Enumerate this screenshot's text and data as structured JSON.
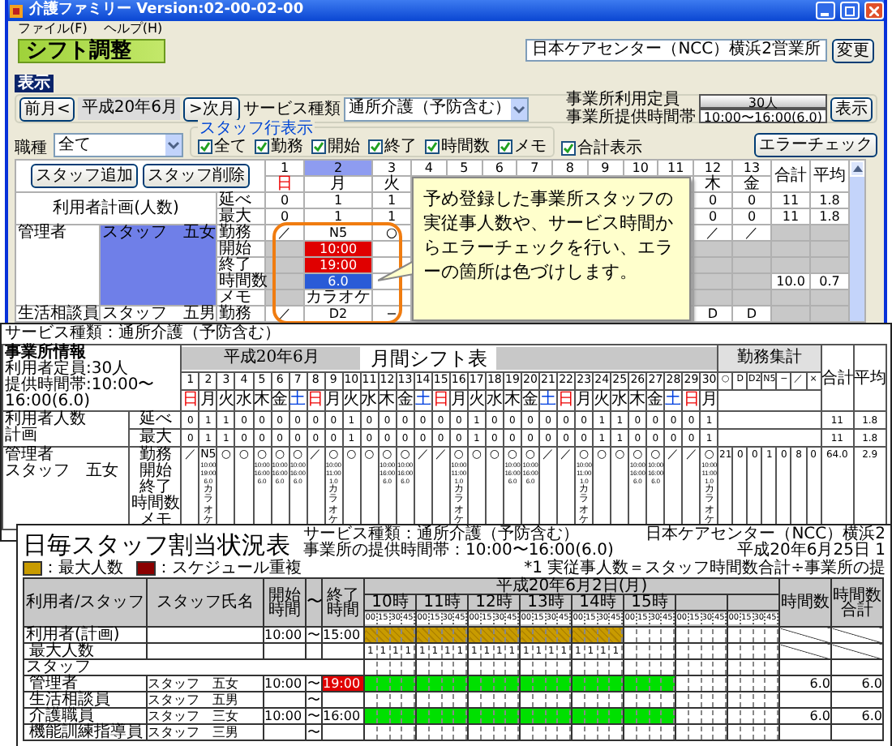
{
  "app_window": {
    "title": "介護ファミリー Version:02-00-02-00",
    "menu": [
      "ファイル(F)",
      "ヘルプ(H)"
    ],
    "heading": "シフト調整",
    "office": "日本ケアセンター（NCC）横浜2営業所",
    "change_button": "変更",
    "section_label": "表示",
    "prev_button": "前月<",
    "month": "平成20年6月",
    "next_button": ">次月",
    "service_label": "サービス種類",
    "service_value": "通所介護（予防含む）",
    "capacity_label": "事業所利用定員",
    "capacity_value": "30人",
    "hours_label": "事業所提供時間帯",
    "hours_value": "10:00〜16:00(6.0)",
    "show_button": "表示",
    "job_label": "職種",
    "job_value": "全て",
    "staff_rows_legend": "スタッフ行表示",
    "row_options": [
      {
        "label": "全て",
        "checked": true
      },
      {
        "label": "勤務",
        "checked": true
      },
      {
        "label": "開始",
        "checked": true
      },
      {
        "label": "終了",
        "checked": true
      },
      {
        "label": "時間数",
        "checked": true
      },
      {
        "label": "メモ",
        "checked": true
      }
    ],
    "total_option": {
      "label": "合計表示",
      "checked": true
    },
    "error_check_button": "エラーチェック",
    "add_staff_button": "スタッフ追加",
    "delete_staff_button": "スタッフ削除",
    "days": [
      {
        "num": "1",
        "dow": "日",
        "kind": "sunday",
        "selected": false
      },
      {
        "num": "2",
        "dow": "月",
        "kind": "weekday",
        "selected": true
      },
      {
        "num": "3",
        "dow": "火",
        "kind": "weekday",
        "selected": false
      },
      {
        "num": "4",
        "selected": false
      },
      {
        "num": "5",
        "selected": false
      },
      {
        "num": "6",
        "selected": false
      },
      {
        "num": "7",
        "selected": false
      },
      {
        "num": "8",
        "selected": false
      },
      {
        "num": "9",
        "selected": false
      },
      {
        "num": "10",
        "selected": false
      },
      {
        "num": "11",
        "selected": false
      },
      {
        "num": "12",
        "dow": "木",
        "kind": "weekday",
        "selected": false
      },
      {
        "num": "13",
        "dow": "金",
        "kind": "weekday",
        "selected": false
      }
    ],
    "total_header": "合計",
    "average_header": "平均",
    "plan_label": "利用者計画(人数)",
    "plan_rows": [
      {
        "label": "延べ",
        "total": "11",
        "average": "1.8",
        "cells": [
          "0",
          "1",
          "1"
        ],
        "end_cells": [
          "0",
          "0"
        ]
      },
      {
        "label": "最大",
        "total": "11",
        "average": "1.8",
        "cells": [
          "0",
          "1",
          "1"
        ],
        "end_cells": [
          "0",
          "0"
        ]
      }
    ],
    "staff": [
      {
        "role": "管理者",
        "name": "スタッフ　五女",
        "selected": true,
        "rows": [
          {
            "label": "勤務",
            "cells": [
              {
                "kind": "plain",
                "text": "／"
              },
              {
                "kind": "plain",
                "text": "N5"
              },
              {
                "kind": "plain",
                "text": "○"
              }
            ],
            "end_cells": [
              {
                "kind": "plain",
                "text": "／"
              },
              {
                "kind": "plain",
                "text": "／"
              }
            ]
          },
          {
            "label": "開始",
            "cells": [
              {
                "kind": "gray"
              },
              {
                "kind": "error",
                "text": "10:00"
              },
              {
                "kind": "plain"
              }
            ],
            "end_cells": [
              {
                "kind": "gray"
              },
              {
                "kind": "gray"
              }
            ]
          },
          {
            "label": "終了",
            "cells": [
              {
                "kind": "gray"
              },
              {
                "kind": "error",
                "text": "19:00"
              },
              {
                "kind": "plain"
              }
            ],
            "end_cells": [
              {
                "kind": "gray"
              },
              {
                "kind": "gray"
              }
            ]
          },
          {
            "label": "時間数",
            "total": "10.0",
            "average": "0.7",
            "cells": [
              {
                "kind": "gray"
              },
              {
                "kind": "active",
                "text": "6.0"
              },
              {
                "kind": "plain"
              }
            ],
            "end_cells": [
              {
                "kind": "gray"
              },
              {
                "kind": "gray"
              }
            ]
          },
          {
            "label": "メモ",
            "cells": [
              {
                "kind": "gray"
              },
              {
                "kind": "plain",
                "text": "カラオケ"
              },
              {
                "kind": "plain"
              }
            ],
            "end_cells": [
              {
                "kind": "gray"
              },
              {
                "kind": "gray"
              }
            ]
          }
        ]
      },
      {
        "role": "生活相談員",
        "name": "スタッフ　五男",
        "selected": false,
        "rows": [
          {
            "label": "勤務",
            "cells": [
              {
                "kind": "plain",
                "text": "／"
              },
              {
                "kind": "plain",
                "text": "D2"
              },
              {
                "kind": "plain",
                "text": "−"
              }
            ],
            "end_cells": [
              {
                "kind": "plain",
                "text": "D"
              },
              {
                "kind": "plain",
                "text": "D"
              }
            ]
          }
        ]
      }
    ],
    "callout": "予め登録した事業所スタッフの実従事人数や、サービス時間からエラーチェックを行い、エラーの箇所は色づけします。"
  },
  "monthly_sheet": {
    "service": "サービス種類：通所介護（予防含む）",
    "info_labels": [
      "事業所情報",
      "利用者定員:30人",
      "提供時間帯:10:00〜16:00(6.0)"
    ],
    "month": "平成20年6月",
    "title": "月間シフト表",
    "summary_header": "勤務集計",
    "summary_symbols": [
      "○",
      "D",
      "D2",
      "N5",
      "−",
      "／",
      "×"
    ],
    "total_header": "合計",
    "average_header": "平均",
    "days": [
      {
        "num": "1",
        "dow": "日",
        "kind": "sunday"
      },
      {
        "num": "2",
        "dow": "月",
        "kind": "weekday"
      },
      {
        "num": "3",
        "dow": "火",
        "kind": "weekday"
      },
      {
        "num": "4",
        "dow": "水",
        "kind": "weekday"
      },
      {
        "num": "5",
        "dow": "木",
        "kind": "weekday"
      },
      {
        "num": "6",
        "dow": "金",
        "kind": "weekday"
      },
      {
        "num": "7",
        "dow": "土",
        "kind": "saturday"
      },
      {
        "num": "8",
        "dow": "日",
        "kind": "sunday"
      },
      {
        "num": "9",
        "dow": "月",
        "kind": "weekday"
      },
      {
        "num": "10",
        "dow": "火",
        "kind": "weekday"
      },
      {
        "num": "11",
        "dow": "水",
        "kind": "weekday"
      },
      {
        "num": "12",
        "dow": "木",
        "kind": "weekday"
      },
      {
        "num": "13",
        "dow": "金",
        "kind": "weekday"
      },
      {
        "num": "14",
        "dow": "土",
        "kind": "saturday"
      },
      {
        "num": "15",
        "dow": "日",
        "kind": "sunday"
      },
      {
        "num": "16",
        "dow": "月",
        "kind": "weekday"
      },
      {
        "num": "17",
        "dow": "火",
        "kind": "weekday"
      },
      {
        "num": "18",
        "dow": "水",
        "kind": "weekday"
      },
      {
        "num": "19",
        "dow": "木",
        "kind": "weekday"
      },
      {
        "num": "20",
        "dow": "金",
        "kind": "weekday"
      },
      {
        "num": "21",
        "dow": "土",
        "kind": "saturday"
      },
      {
        "num": "22",
        "dow": "日",
        "kind": "sunday"
      },
      {
        "num": "23",
        "dow": "月",
        "kind": "weekday"
      },
      {
        "num": "24",
        "dow": "火",
        "kind": "weekday"
      },
      {
        "num": "25",
        "dow": "水",
        "kind": "weekday"
      },
      {
        "num": "26",
        "dow": "木",
        "kind": "weekday"
      },
      {
        "num": "27",
        "dow": "金",
        "kind": "weekday"
      },
      {
        "num": "28",
        "dow": "土",
        "kind": "saturday"
      },
      {
        "num": "29",
        "dow": "日",
        "kind": "sunday"
      },
      {
        "num": "30",
        "dow": "月",
        "kind": "weekday"
      }
    ],
    "plan_labels": [
      "利用者人数",
      "計画"
    ],
    "plan_rows": [
      {
        "label": "延べ",
        "total": "11",
        "average": "1.8",
        "values": [
          "0",
          "1",
          "1",
          "0",
          "0",
          "0",
          "0",
          "0",
          "0",
          "1",
          "0",
          "0",
          "0",
          "0",
          "0",
          "0",
          "1",
          "0",
          "0",
          "0",
          "0",
          "0",
          "0",
          "1",
          "1",
          "0",
          "0",
          "0",
          "0",
          "1"
        ]
      },
      {
        "label": "最大",
        "total": "11",
        "average": "1.8",
        "values": [
          "0",
          "1",
          "1",
          "0",
          "0",
          "0",
          "0",
          "0",
          "0",
          "1",
          "0",
          "0",
          "0",
          "0",
          "0",
          "0",
          "1",
          "0",
          "0",
          "0",
          "0",
          "0",
          "0",
          "1",
          "1",
          "0",
          "0",
          "0",
          "0",
          "1"
        ]
      }
    ],
    "staff": [
      {
        "role": "管理者",
        "name": "スタッフ　五女",
        "row_labels": [
          "勤務",
          "開始",
          "終了",
          "時間数",
          "メモ"
        ],
        "summary": [
          "21",
          "0",
          "0",
          "1",
          "0",
          "8",
          "0"
        ],
        "total": "64.0",
        "average": "2.9",
        "days": [
          {
            "mark": "／"
          },
          {
            "mark": "N5",
            "start": "10:00",
            "end": "19:00",
            "hours": "6.0",
            "memo": "カラオケ"
          },
          {
            "mark": "○"
          },
          {
            "mark": "○"
          },
          {
            "mark": "○",
            "start": "10:00",
            "end": "16:00",
            "hours": "6.0"
          },
          {
            "mark": "○",
            "start": "10:00",
            "end": "16:00",
            "hours": "6.0"
          },
          {
            "mark": "○",
            "start": "10:00",
            "end": "16:00",
            "hours": "6.0"
          },
          {
            "mark": "／"
          },
          {
            "mark": "○",
            "start": "10:00",
            "end": "11:00",
            "hours": "1.0",
            "memo": "カラオケ"
          },
          {
            "mark": "○"
          },
          {
            "mark": "○"
          },
          {
            "mark": "○",
            "start": "10:00",
            "end": "16:00",
            "hours": "6.0"
          },
          {
            "mark": "○",
            "start": "10:00",
            "end": "16:00",
            "hours": "6.0"
          },
          {
            "mark": "／"
          },
          {
            "mark": "／"
          },
          {
            "mark": "○",
            "start": "10:00",
            "end": "11:00",
            "hours": "1.0",
            "memo": "カラオケ"
          },
          {
            "mark": "○"
          },
          {
            "mark": "○"
          },
          {
            "mark": "○",
            "start": "10:00",
            "end": "16:00",
            "hours": "6.0"
          },
          {
            "mark": "○",
            "start": "10:00",
            "end": "16:00",
            "hours": "6.0"
          },
          {
            "mark": "／"
          },
          {
            "mark": "／"
          },
          {
            "mark": "○",
            "start": "10:00",
            "end": "11:00",
            "hours": "1.0",
            "memo": "カラオケ"
          },
          {
            "mark": "○"
          },
          {
            "mark": "○"
          },
          {
            "mark": "○",
            "start": "10:00",
            "end": "16:00",
            "hours": "6.0"
          },
          {
            "mark": "○",
            "start": "10:00",
            "end": "16:00",
            "hours": "6.0"
          },
          {
            "mark": "／"
          },
          {
            "mark": "／"
          },
          {
            "mark": "○",
            "start": "10:00",
            "end": "11:00",
            "hours": "1.0",
            "memo": "カラオケ"
          }
        ]
      }
    ]
  },
  "daily_sheet": {
    "title": "日毎スタッフ割当状況表",
    "service": "サービス種類：通所介護（予防含む）",
    "hours": "事業所の提供時間帯：10:00〜16:00(6.0)",
    "office": "日本ケアセンター（NCC）横浜2",
    "date": "平成20年6月25日 1",
    "legend": [
      {
        "label": "：最大人数",
        "color": "#c89b00"
      },
      {
        "label": "：スケジュール重複",
        "color": "#8b0000"
      }
    ],
    "note": "*1 実従事人数＝スタッフ時間数合計÷事業所の提",
    "columns": {
      "person": "利用者/スタッフ",
      "name": "スタッフ氏名",
      "start": "開始時間",
      "tilde": "〜",
      "end": "終了時間",
      "hours": "時間数",
      "hours_total": "時間数合計"
    },
    "day": "平成20年6月2日(月)",
    "hour_labels": [
      "10時",
      "11時",
      "12時",
      "13時",
      "14時",
      "15時"
    ],
    "quarters": [
      "00",
      "15",
      "30",
      "45",
      "00",
      "15",
      "30",
      "45",
      "00",
      "15",
      "30",
      "45",
      "00",
      "15",
      "30",
      "45",
      "00",
      "15",
      "30",
      "45",
      "00",
      "15",
      "30",
      "45",
      "00",
      "15",
      "30",
      "45",
      "00",
      "15",
      "30",
      "45"
    ],
    "rows": [
      {
        "kind": "plan",
        "label": "利用者(計画)",
        "start": "10:00",
        "tilde": "〜",
        "end": "15:00",
        "filled": [
          true,
          true,
          true,
          true,
          true,
          false,
          false,
          false
        ]
      },
      {
        "kind": "count",
        "label": "最大人数",
        "counts": [
          "1",
          "1",
          "1",
          "1",
          "1",
          "1",
          "1",
          "1",
          "1",
          "1",
          "1",
          "1",
          "1",
          "1",
          "1",
          "1",
          "1",
          "1",
          "1",
          "1"
        ]
      },
      {
        "kind": "section",
        "label": "スタッフ"
      },
      {
        "kind": "staff",
        "label": "管理者",
        "name": "スタッフ　五女",
        "start": "10:00",
        "tilde": "〜",
        "end": "19:00",
        "end_error": true,
        "filled": [
          true,
          true,
          true,
          true,
          true,
          true,
          false,
          false
        ],
        "hours": "6.0",
        "hours_total": "6.0"
      },
      {
        "kind": "staff",
        "label": "生活相談員",
        "name": "スタッフ　五男",
        "tilde": "〜",
        "end_error": false,
        "filled": [
          false,
          false,
          false,
          false,
          false,
          false,
          false,
          false
        ]
      },
      {
        "kind": "staff",
        "label": "介護職員",
        "name": "スタッフ　三女",
        "start": "10:00",
        "tilde": "〜",
        "end": "16:00",
        "end_error": false,
        "filled": [
          true,
          true,
          true,
          true,
          true,
          true,
          false,
          false
        ],
        "hours": "6.0",
        "hours_total": "6.0"
      },
      {
        "kind": "staff",
        "label": "機能訓練指導員",
        "name": "スタッフ　三男",
        "tilde": "〜",
        "end_error": false,
        "filled": [
          false,
          false,
          false,
          false,
          false,
          false,
          false,
          false
        ]
      }
    ]
  }
}
